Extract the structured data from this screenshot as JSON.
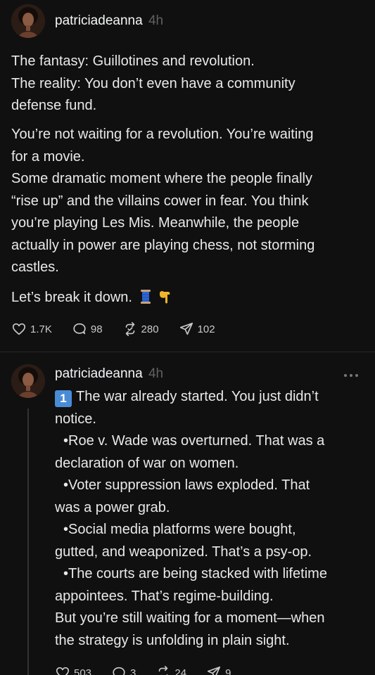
{
  "post1": {
    "username": "patriciadeanna",
    "time": "4h",
    "lines": {
      "l1": "The fantasy: Guillotines and revolution.",
      "l2": "The reality: You don’t even have a community",
      "l3": "defense fund.",
      "l4": "You’re not waiting for a revolution. You’re waiting",
      "l5": "for a movie.",
      "l6": "Some dramatic moment where the people finally",
      "l7": "“rise up” and the villains cower in fear. You think",
      "l8": "you’re playing Les Mis. Meanwhile, the people",
      "l9": "actually in power are playing chess, not storming",
      "l10": "castles.",
      "l11": "Let’s break it down."
    },
    "stats": {
      "likes": "1.7K",
      "comments": "98",
      "reposts": "280",
      "shares": "102"
    }
  },
  "post2": {
    "username": "patriciadeanna",
    "time": "4h",
    "number_emoji": "1",
    "lines": {
      "l1": "The war already started. You just didn’t",
      "l2": "notice.",
      "l3": "•Roe v. Wade was overturned. That was a",
      "l4": "declaration of war on women.",
      "l5": "•Voter suppression laws exploded. That",
      "l6": "was a power grab.",
      "l7": "•Social media platforms were bought,",
      "l8": "gutted, and weaponized. That’s a psy-op.",
      "l9": "•The courts are being stacked with lifetime",
      "l10": "appointees. That’s regime-building.",
      "l11": "But you’re still waiting for a moment—when",
      "l12": "the strategy is unfolding in plain sight."
    },
    "stats": {
      "likes": "503",
      "comments": "3",
      "reposts": "24",
      "shares": "9"
    }
  },
  "icons": {
    "like": "heart-icon",
    "comment": "comment-bubble-icon",
    "repost": "repost-icon",
    "share": "send-icon",
    "more": "more-dots-icon"
  },
  "colors": {
    "background": "#101010",
    "text": "#f3f5f7",
    "muted": "#616161"
  }
}
